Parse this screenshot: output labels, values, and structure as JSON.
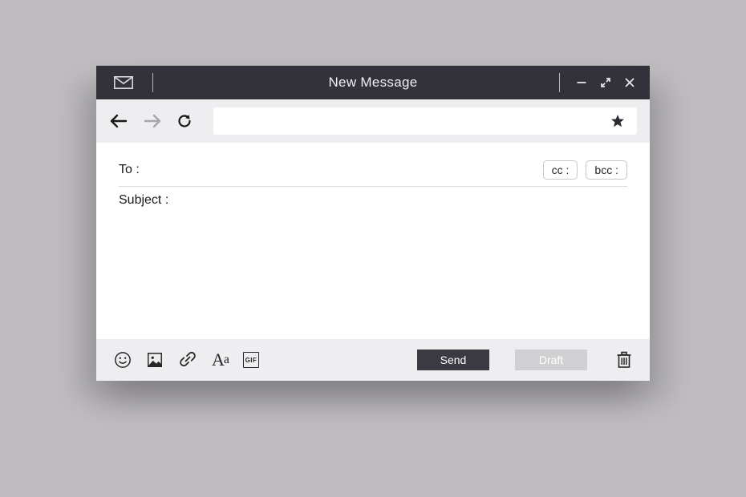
{
  "titlebar": {
    "title": "New Message"
  },
  "address": {
    "value": ""
  },
  "fields": {
    "to_label": "To :",
    "subject_label": "Subject :",
    "cc_label": "cc :",
    "bcc_label": "bcc :"
  },
  "footer": {
    "gif_label": "GIF",
    "send_label": "Send",
    "draft_label": "Draft"
  }
}
